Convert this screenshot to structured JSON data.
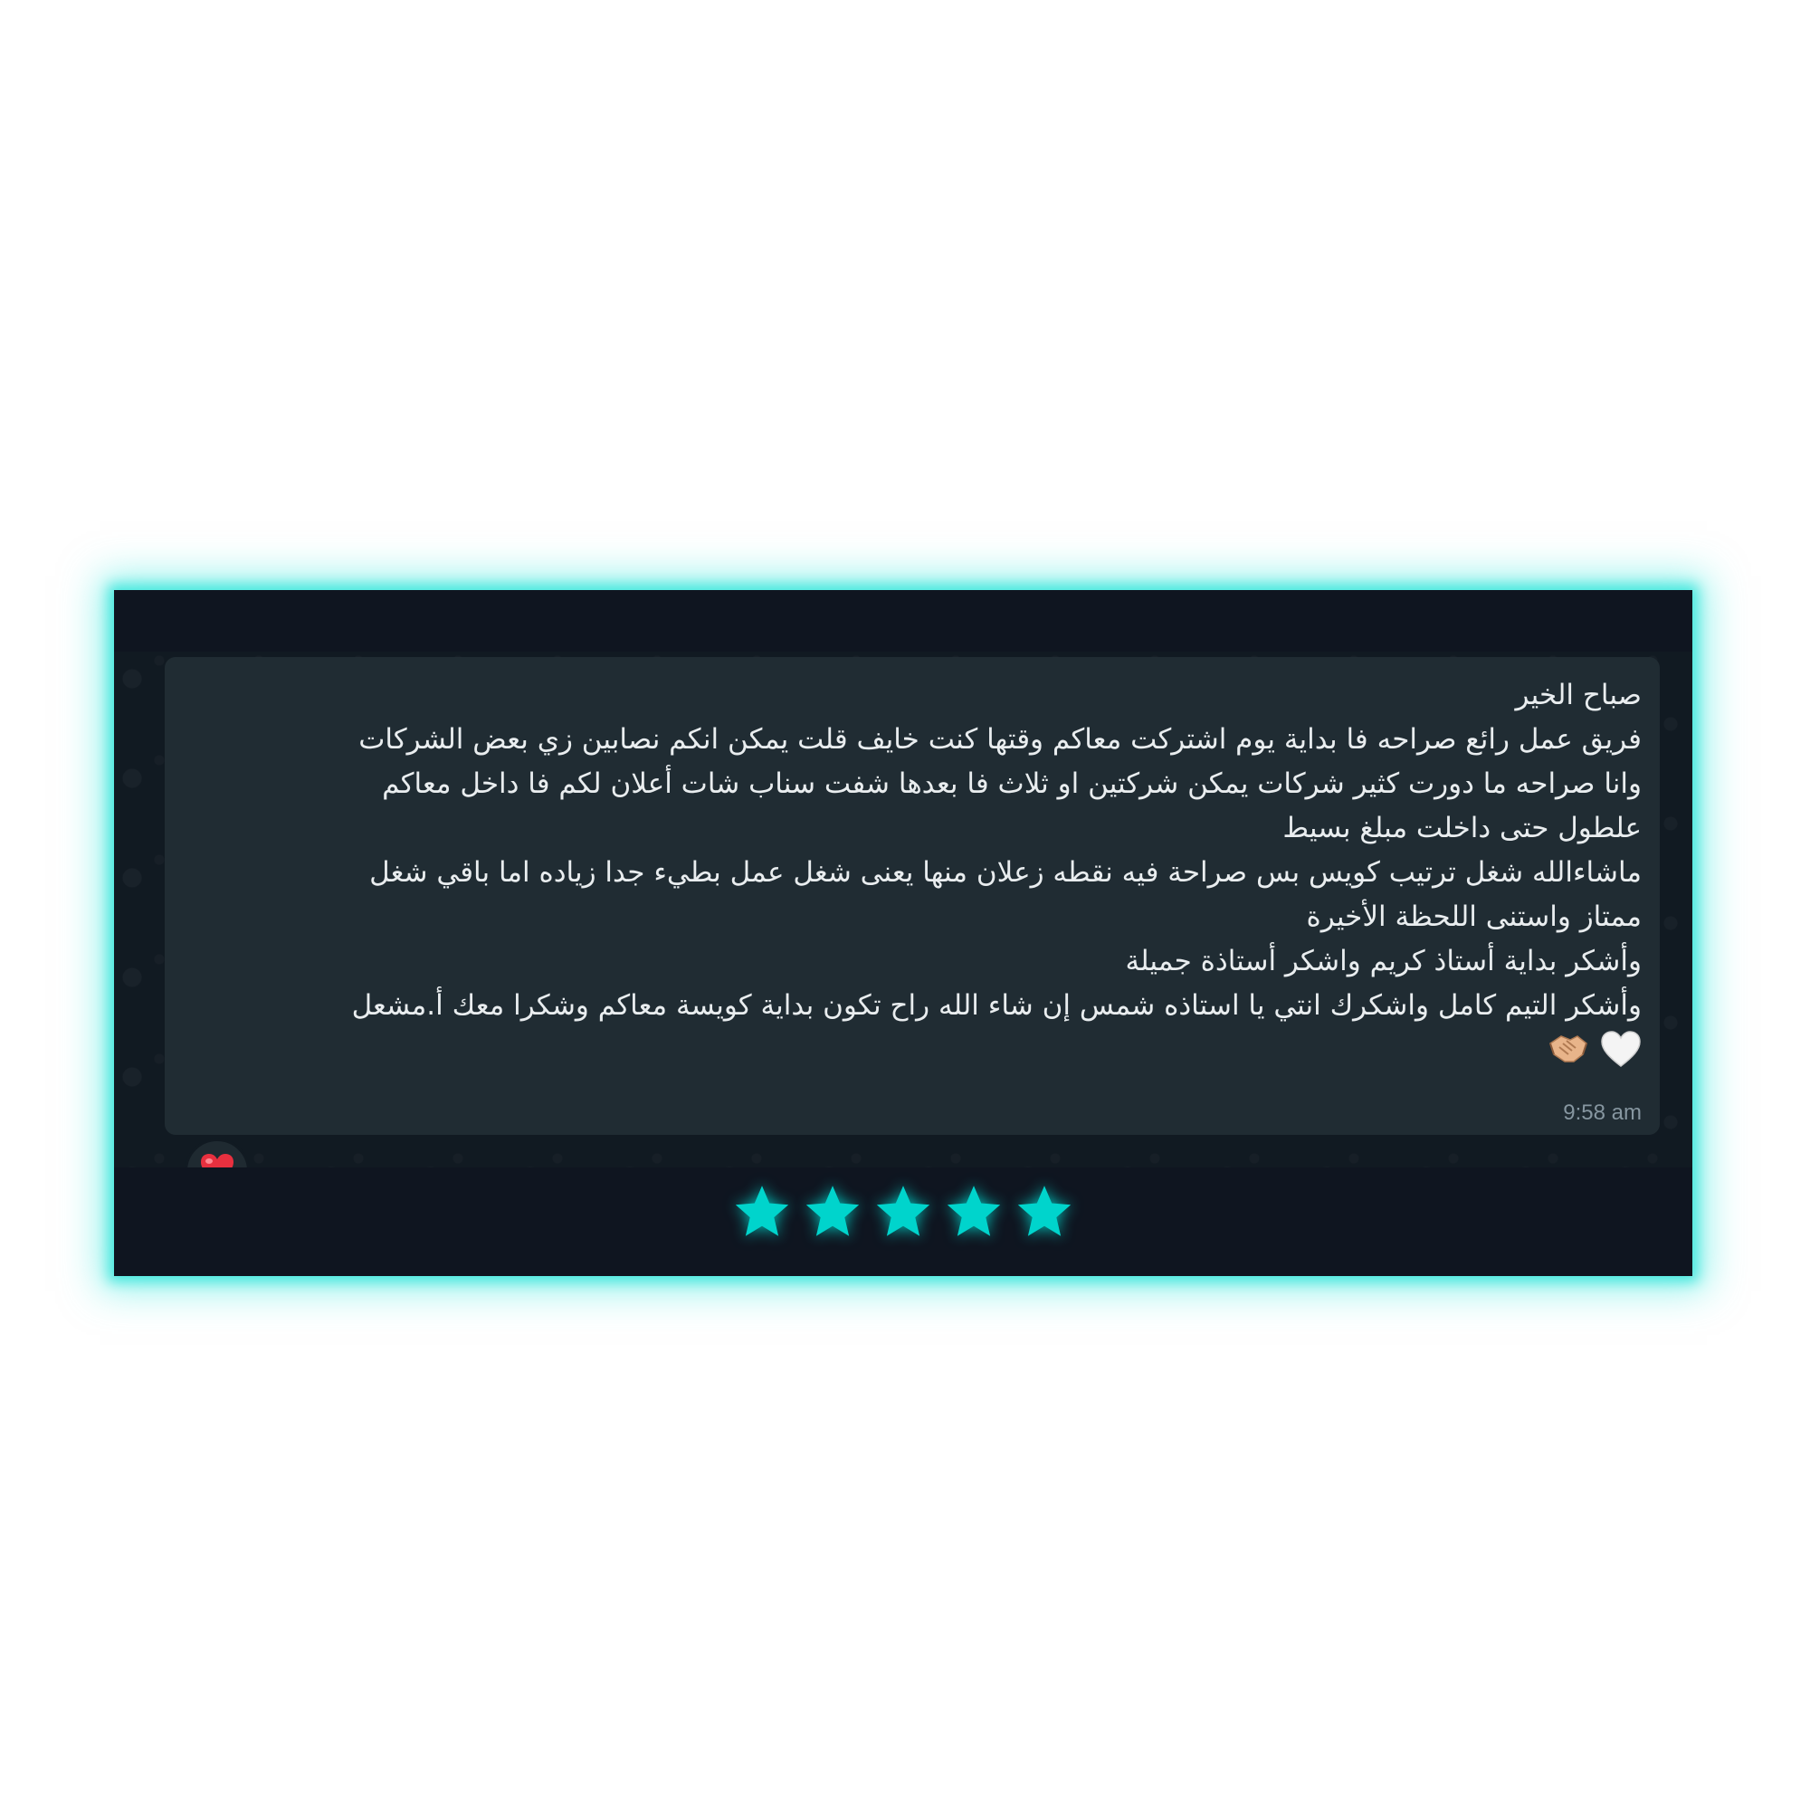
{
  "message": {
    "lines": [
      "صباح الخير",
      "فريق عمل رائع صراحه فا بداية يوم اشتركت معاكم وقتها كنت خايف قلت يمكن انكم نصابين زي بعض الشركات",
      "وانا صراحه ما دورت كثير شركات يمكن شركتين او ثلاث فا بعدها شفت سناب شات أعلان لكم فا داخل معاكم",
      "علطول حتى داخلت مبلغ بسيط",
      "ماشاءالله شغل ترتيب كويس بس صراحة فيه نقطه زعلان منها يعنى شغل عمل بطيء جدا زياده اما باقي شغل",
      "ممتاز واستنى اللحظة الأخيرة",
      "وأشكر بداية أستاذ كريم واشكر أستاذة جميلة",
      "وأشكر التيم كامل واشكرك انتي يا استاذه شمس إن شاء الله راح تكون بداية كويسة معاكم وشكرا  معك أ.مشعل"
    ],
    "emojis": [
      "white-heart-icon",
      "handshake-icon"
    ],
    "time": "9:58 am",
    "reaction": "red-heart-icon"
  },
  "rating": {
    "value": 5,
    "max": 5,
    "color": "#00d4cc"
  },
  "colors": {
    "glow": "#46e8de",
    "card_bg": "#0f1520",
    "bubble_bg": "#202c33",
    "text": "#e9edef",
    "time": "#8696a0"
  }
}
